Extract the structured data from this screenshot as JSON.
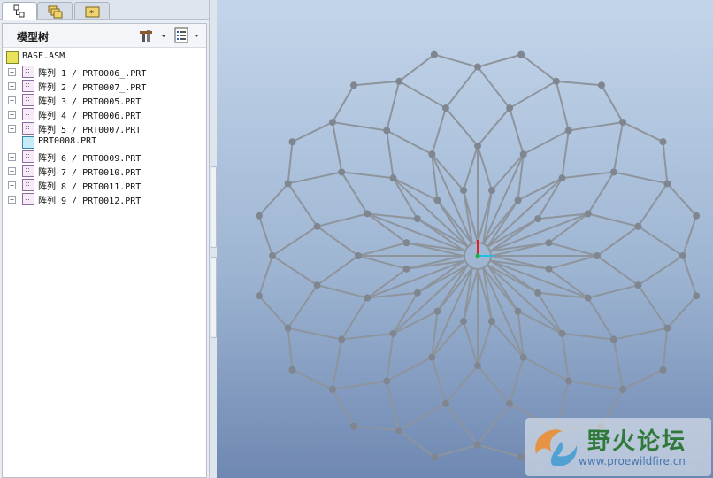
{
  "tabs": [
    {
      "name": "model-tree-tab"
    },
    {
      "name": "layers-tab"
    },
    {
      "name": "favorites-tab"
    }
  ],
  "panel": {
    "title": "模型树"
  },
  "tree": {
    "root": "BASE.ASM",
    "items": [
      {
        "label": "阵列 1 / PRT0006_.PRT",
        "kind": "pattern"
      },
      {
        "label": "阵列 2 / PRT0007_.PRT",
        "kind": "pattern"
      },
      {
        "label": "阵列 3 / PRT0005.PRT",
        "kind": "pattern"
      },
      {
        "label": "阵列 4 / PRT0006.PRT",
        "kind": "pattern"
      },
      {
        "label": "阵列 5 / PRT0007.PRT",
        "kind": "pattern"
      },
      {
        "label": "PRT0008.PRT",
        "kind": "part"
      },
      {
        "label": "阵列 6 / PRT0009.PRT",
        "kind": "pattern"
      },
      {
        "label": "阵列 7 / PRT0010.PRT",
        "kind": "pattern"
      },
      {
        "label": "阵列 8 / PRT0011.PRT",
        "kind": "pattern"
      },
      {
        "label": "阵列 9 / PRT0012.PRT",
        "kind": "pattern"
      }
    ]
  },
  "watermark": {
    "cn": "野火论坛",
    "url": "www.proewildfire.cn"
  }
}
